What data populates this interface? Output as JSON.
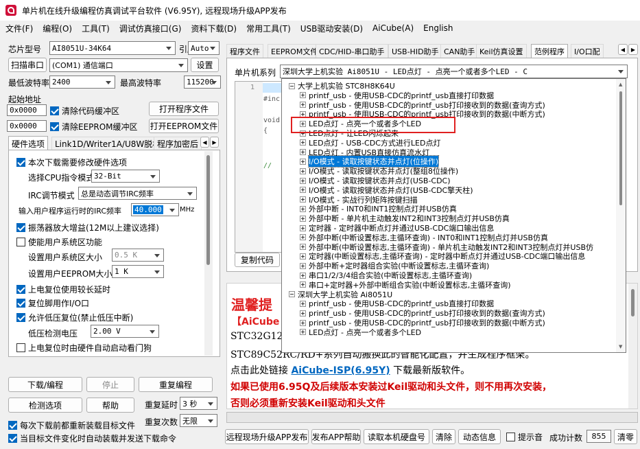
{
  "window": {
    "title": "单片机在线升级编程仿真调试平台软件 (V6.95Y), 远程现场升级APP发布",
    "colors": {
      "accent": "#0067c0",
      "red": "#e02020",
      "link": "#0067c0",
      "titlebar": "#ffffff"
    }
  },
  "menu": [
    "文件(F)",
    "编程(O)",
    "工具(T)",
    "调试仿真接口(G)",
    "资料下载(D)",
    "常用工具(T)",
    "USB驱动安装(D)",
    "AiCube(A)",
    "English"
  ],
  "left": {
    "chip_label": "芯片型号",
    "chip_value": "AI8051U-34K64",
    "pins_label": "引脚数",
    "pins_value": "Auto",
    "scan_btn": "扫描串口",
    "port_value": "(COM1) 通信端口",
    "settings_btn": "设置",
    "minbaud_label": "最低波特率",
    "minbaud_value": "2400",
    "maxbaud_label": "最高波特率",
    "maxbaud_value": "115200",
    "start_addr_label": "起始地址",
    "addr1": "0x0000",
    "clear_code": "清除代码缓冲区",
    "open_prog": "打开程序文件",
    "addr2": "0x0000",
    "clear_eeprom": "清除EEPROM缓冲区",
    "open_eeprom": "打开EEPROM文件",
    "tabs": [
      "硬件选项",
      "Link1D/Writer1A/U8W脱机",
      "程序加密后"
    ],
    "hw": {
      "modify": "本次下载需要修改硬件选项",
      "cpu_label": "选择CPU指令模式",
      "cpu_value": "32-Bit",
      "irc_label": "IRC调节模式",
      "irc_value": "总是动态调节IRC频率",
      "freq_label": "输入用户程序运行时的IRC频率",
      "freq_value": "40.000",
      "freq_unit": "MHz",
      "osc": "振荡器放大增益(12M以上建议选择)",
      "user_sys": "使能用户系统区功能",
      "sys_size_label": "设置用户系统区大小",
      "sys_size_value": "0.5 K",
      "ee_size_label": "设置用户EEPROM大小",
      "ee_size_value": "1   K",
      "long_delay": "上电复位使用较长延时",
      "reset_io": "复位脚用作I/O口",
      "lvr": "允许低压复位(禁止低压中断)",
      "lv_label": "低压检测电压",
      "lv_value": "2.00 V",
      "wdt": "上电复位时由硬件自动启动看门狗"
    },
    "download_btn": "下载/编程",
    "stop_btn": "停止",
    "reprog_btn": "重复编程",
    "check_btn": "检测选项",
    "help_btn": "帮助",
    "delay_label": "重复延时",
    "delay_value": "3 秒",
    "count_label": "重复次数",
    "count_value": "无限",
    "reload": "每次下载前都重新装载目标文件",
    "autoload": "当目标文件变化时自动装载并发送下载命令"
  },
  "right": {
    "tabs": [
      "程序文件",
      "EEPROM文件",
      "CDC/HID-串口助手",
      "USB-HID助手",
      "CAN助手",
      "Keil仿真设置",
      "范例程序",
      "I/O口配"
    ],
    "series_label": "单片机系列",
    "series_value": "深圳大学上机实验 Ai8051U - LED点灯 - 点亮一个或者多个LED - C",
    "code_lines": [
      "#inc",
      "void",
      "{",
      "//"
    ],
    "copy_btn": "复制代码",
    "notice_title": "温馨提",
    "notice_lines": [
      "【AiCube",
      "STC32G12",
      "STC89C52RC/RD+系列自动搬换此的智能化配置，并生成程序框架。"
    ],
    "link_prefix": "点击此处链接",
    "link_text": "AiCube-ISP(6.95Y)",
    "link_suffix": "下载最新版软件。",
    "red1": "如果已使用6.95Q及后续版本安装过Keil驱动和头文件，则不用再次安装，",
    "red2": "否则必须重新安装Keil驱动和头文件",
    "bottom": {
      "publish": "远程现场升级APP发布",
      "pub_help": "发布APP帮助",
      "read_disk": "读取本机硬盘号",
      "clear": "清除",
      "dyninfo": "动态信息",
      "tone": "提示音",
      "success_label": "成功计数",
      "success_value": "855",
      "clear2": "清零"
    }
  },
  "tree": [
    {
      "t": "大学上机实验 STC8H8K64U",
      "lvl": 0,
      "pm": "minus"
    },
    {
      "t": "printf_usb - 使用USB-CDC的printf_usb直接打印数据",
      "lvl": 1
    },
    {
      "t": "printf_usb - 使用USB-CDC的printf_usb打印接收到的数据(查询方式)",
      "lvl": 1
    },
    {
      "t": "printf_usb - 使用USB-CDC的printf_usb打印接收到的数据(中断方式)",
      "lvl": 1
    },
    {
      "t": "LED点灯 - 点亮一个或者多个LED",
      "lvl": 1
    },
    {
      "t": "LED点灯 - 让LED闪烁起来",
      "lvl": 1
    },
    {
      "t": "LED点灯 - USB-CDC方式进行LED点灯",
      "lvl": 1
    },
    {
      "t": "LED点灯 - 内置USB直接仿真流水灯",
      "lvl": 1
    },
    {
      "t": "I/O模式 - 读取按键状态并点灯(位操作)",
      "lvl": 1,
      "hl": true
    },
    {
      "t": "I/O模式 - 读取按键状态并点灯(整组8位操作)",
      "lvl": 1
    },
    {
      "t": "I/O模式 - 读取按键状态并点灯(USB-CDC)",
      "lvl": 1
    },
    {
      "t": "I/O模式 - 读取按键状态并点灯(USB-CDC擎天柱)",
      "lvl": 1
    },
    {
      "t": "I/O模式 - 实战行列矩阵按键扫描",
      "lvl": 1
    },
    {
      "t": "外部中断 - INT0和INT1控制点灯并USB仿真",
      "lvl": 1
    },
    {
      "t": "外部中断 - 单片机主动触发INT2和INT3控制点灯并USB仿真",
      "lvl": 1
    },
    {
      "t": "定时器 - 定时器中断点灯并通过USB-CDC端口输出信息",
      "lvl": 1
    },
    {
      "t": "外部中断(中断设置标志,主循环查询) - INT0和INT1控制点灯并USB仿真",
      "lvl": 1
    },
    {
      "t": "外部中断(中断设置标志,主循环查询) - 单片机主动触发INT2和INT3控制点灯并USB仿",
      "lvl": 1
    },
    {
      "t": "定时器(中断设置标志,主循环查询) - 定时器中断点灯并通过USB-CDC端口输出信息",
      "lvl": 1
    },
    {
      "t": "外部中断+定时器组合实验(中断设置标志,主循环查询)",
      "lvl": 1
    },
    {
      "t": "串口1/2/3/4组合实验(中断设置标志,主循环查询)",
      "lvl": 1
    },
    {
      "t": "串口+定时器+外部中断组合实验(中断设置标志,主循环查询)",
      "lvl": 1
    },
    {
      "t": "深圳大学上机实验 Ai8051U",
      "lvl": 0,
      "pm": "minus"
    },
    {
      "t": "printf_usb - 使用USB-CDC的printf_usb直接打印数据",
      "lvl": 1
    },
    {
      "t": "printf_usb - 使用USB-CDC的printf_usb打印接收到的数据(查询方式)",
      "lvl": 1
    },
    {
      "t": "printf_usb - 使用USB-CDC的printf_usb打印接收到的数据(中断方式)",
      "lvl": 1
    },
    {
      "t": "LED点灯 - 点亮一个或者多个LED",
      "lvl": 1
    }
  ]
}
